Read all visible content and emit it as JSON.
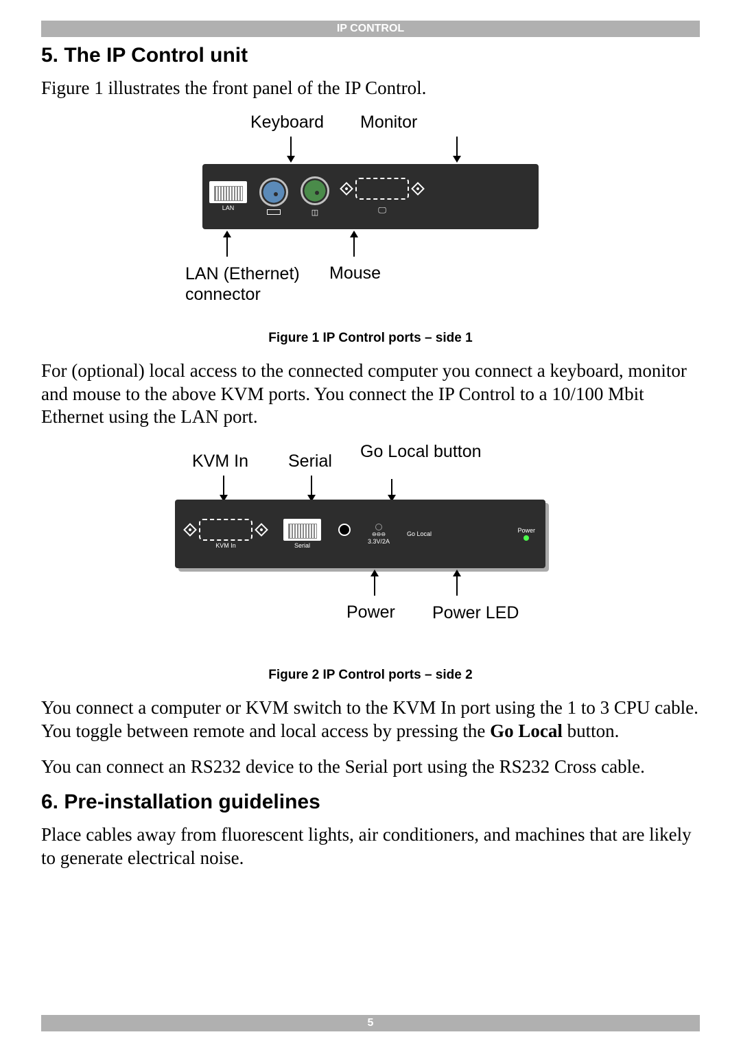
{
  "header": {
    "title": "IP CONTROL"
  },
  "section5": {
    "heading": "5. The IP Control unit",
    "intro": "Figure 1 illustrates the front panel of the IP Control."
  },
  "figure1": {
    "labels": {
      "keyboard": "Keyboard",
      "monitor": "Monitor",
      "lan_connector": "LAN (Ethernet) connector",
      "mouse": "Mouse",
      "lan_port": "LAN"
    },
    "caption": "Figure 1 IP Control ports – side 1"
  },
  "para1": "For (optional) local access to the connected computer you connect a keyboard, monitor and mouse to the above KVM ports. You connect the IP Control to a 10/100 Mbit Ethernet using the LAN port.",
  "figure2": {
    "labels": {
      "kvm_in": "KVM In",
      "serial": "Serial",
      "go_local_button": "Go Local button",
      "power": "Power",
      "power_led": "Power LED",
      "kvm_in_port": "KVM In",
      "serial_port": "Serial",
      "power_spec": "3.3V/2A",
      "power_port": "Power",
      "go_local_port": "Go Local",
      "power_conn_icon": "⊖⊖⊖"
    },
    "caption": "Figure 2 IP Control ports – side 2"
  },
  "para2_pre": "You connect a computer or KVM switch to the KVM In port using the 1 to 3 CPU cable. You toggle between remote and local access by pressing the ",
  "para2_bold": "Go Local",
  "para2_post": " button.",
  "para3": "You can connect an RS232 device to the Serial port using the RS232 Cross cable.",
  "section6": {
    "heading": "6. Pre-installation guidelines",
    "body": "Place cables away from fluorescent lights, air conditioners, and machines that are likely to generate electrical noise."
  },
  "footer": {
    "page": "5"
  }
}
